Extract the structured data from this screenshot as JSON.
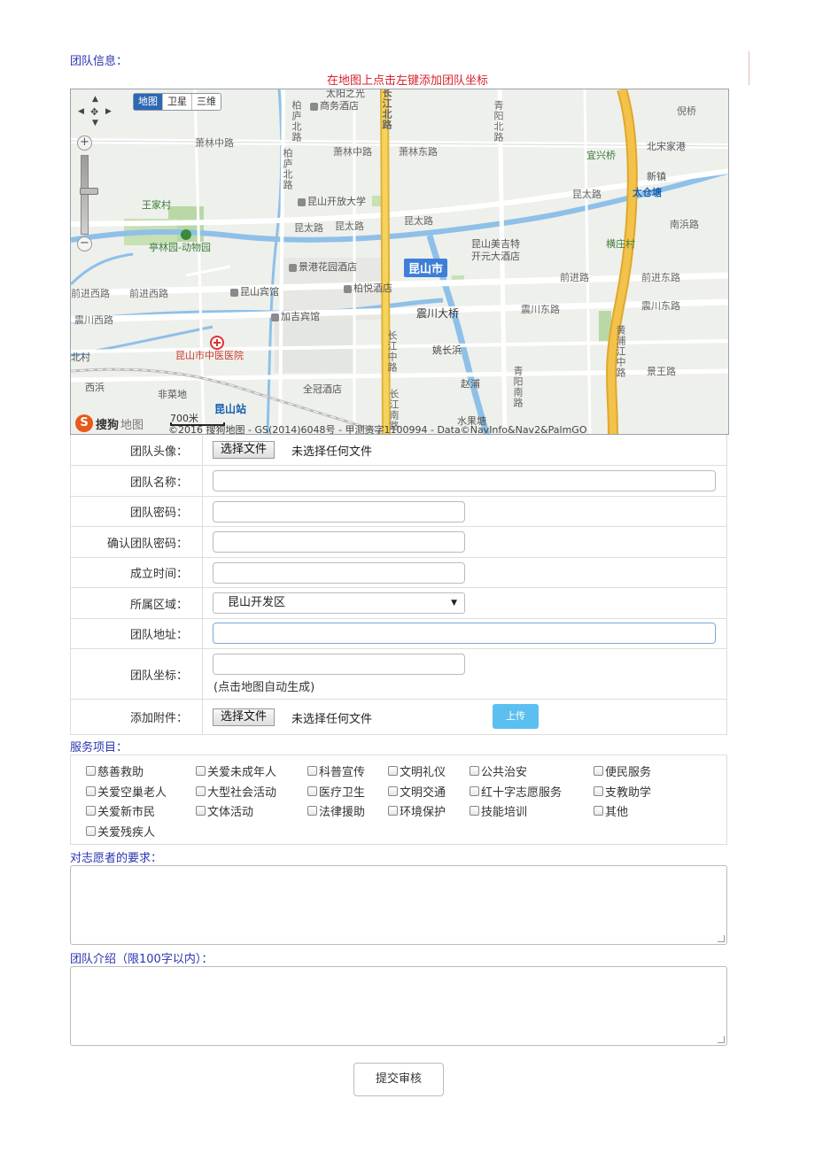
{
  "team_info_title": "团队信息：",
  "map": {
    "hint": "在地图上点击左键添加团队坐标",
    "map_types": [
      "地图",
      "卫星",
      "三维"
    ],
    "logo": "搜狗",
    "logo_suffix": "地图",
    "scale": "700米",
    "copyright": "©2016 搜狗地图 - GS(2014)6048号 - 甲测资字1100994 - Data©NavInfo&Nav2&PalmGO",
    "labels": {
      "city": "昆山市",
      "taiyang": "太阳之光",
      "shangwu": "商务酒店",
      "qingyang_bei": "青阳北路",
      "ni_qiao": "倪桥",
      "xiaolin_zhong": "萧林中路",
      "xiaolin_zhong2": "萧林中路",
      "xiaolin_dong": "萧林东路",
      "yixing_qiao": "宜兴桥",
      "beisong_jiagang": "北宋家港",
      "xinzhen": "新镇",
      "kunshan_kaifa": "昆山开放大学",
      "wangjiacun": "王家村",
      "kuntai_1": "昆太路",
      "kuntai_2": "昆太路",
      "kuntai_3": "昆太路",
      "kuntai_4": "昆太路",
      "taicang_tang": "太仓塘",
      "nanbin": "南浜路",
      "tinglin": "亭林园-动物园",
      "meijite": "昆山美吉特",
      "kaiyuan": "开元大酒店",
      "hengzhuang": "横庄村",
      "jinggang": "景港花园酒店",
      "qianjin_xi": "前进西路",
      "qianjin_xi2": "前进西路",
      "kunshan_binguan": "昆山宾馆",
      "baiyue": "柏悦酒店",
      "qianjin": "前进路",
      "qianjin_dong": "前进东路",
      "zhenchuan_xi": "震川西路",
      "jiaji": "加吉宾馆",
      "zhenchuan_bridge": "震川大桥",
      "zhenchuan_dong": "震川东路",
      "zhenchuan_dong2": "震川东路",
      "zhongyi": "昆山市中医医院",
      "yaochangbin": "姚长浜",
      "changjiang_zhong": "长江中路",
      "huangpujiang": "黄浦江中路",
      "bei_cun": "北村",
      "jingwang": "景王路",
      "xibin": "西浜",
      "feicaidi": "非菜地",
      "quanguan": "全冠酒店",
      "zhaopu": "赵浦",
      "qingyang_nan": "青阳南路",
      "kunshan_station": "昆山站",
      "shuiguotang": "水果塘",
      "bolu_bei": "柏庐北路",
      "bolu_bei2": "柏庐北路",
      "changjiang_bei": "长江北路",
      "changjiang_nan": "长江南路"
    }
  },
  "form": {
    "avatar_label": "团队头像：",
    "file_button": "选择文件",
    "no_file": "未选择任何文件",
    "name_label": "团队名称：",
    "password_label": "团队密码：",
    "confirm_password_label": "确认团队密码：",
    "founded_label": "成立时间：",
    "region_label": "所属区域：",
    "region_value": "昆山开发区",
    "address_label": "团队地址：",
    "coords_label": "团队坐标：",
    "coords_hint": "(点击地图自动生成)",
    "attachment_label": "添加附件：",
    "attachment_button": "选择文件",
    "attachment_none": "未选择任何文件",
    "upload_button": "上传"
  },
  "services_title": "服务项目：",
  "services": [
    "慈善救助",
    "关爱未成年人",
    "科普宣传",
    "文明礼仪",
    "公共治安",
    "便民服务",
    "关爱空巢老人",
    "大型社会活动",
    "医疗卫生",
    "文明交通",
    "红十字志愿服务",
    "支教助学",
    "关爱新市民",
    "文体活动",
    "法律援助",
    "环境保护",
    "技能培训",
    "其他",
    "关爱残疾人"
  ],
  "requirements_title": "对志愿者的要求：",
  "intro_title": "团队介绍（限100字以内）：",
  "submit_label": "提交审核"
}
